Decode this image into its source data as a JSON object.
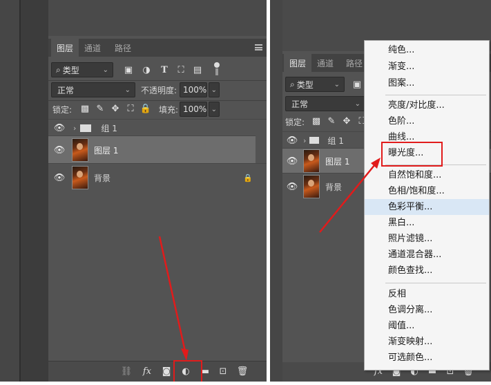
{
  "left": {
    "tabs": [
      "图层",
      "通道",
      "路径"
    ],
    "menu_icon": "menu-lines-icon",
    "filter_kind": "类型",
    "filter_icons": [
      "image-icon",
      "adjustment-icon",
      "text-icon",
      "transform-icon",
      "smart-object-icon",
      "toggle-icon"
    ],
    "blend_mode": "正常",
    "opacity_label": "不透明度:",
    "opacity_value": "100%",
    "lock_label": "锁定:",
    "fill_label": "填充:",
    "fill_value": "100%",
    "layers": [
      {
        "name": "组 1",
        "type": "group"
      },
      {
        "name": "图层 1",
        "type": "layer",
        "selected": true
      },
      {
        "name": "背景",
        "type": "background",
        "locked": true
      }
    ],
    "footer_icons": [
      "link-icon",
      "fx-icon",
      "mask-icon",
      "adjustment-layer-icon",
      "folder-icon",
      "new-layer-icon",
      "trash-icon"
    ]
  },
  "right": {
    "tabs": [
      "图层",
      "通道",
      "路径"
    ],
    "filter_kind": "类型",
    "blend_mode": "正常",
    "lock_label": "锁定:",
    "layers": [
      {
        "name": "组 1",
        "type": "group"
      },
      {
        "name": "图层 1",
        "type": "layer",
        "selected": true
      },
      {
        "name": "背景",
        "type": "background"
      }
    ],
    "menu": {
      "groups": [
        [
          "纯色...",
          "渐变...",
          "图案..."
        ],
        [
          "亮度/对比度...",
          "色阶...",
          "曲线...",
          "曝光度..."
        ],
        [
          "自然饱和度...",
          "色相/饱和度...",
          "色彩平衡...",
          "黑白...",
          "照片滤镜...",
          "通道混合器...",
          "颜色查找..."
        ],
        [
          "反相",
          "色调分离...",
          "阈值...",
          "渐变映射...",
          "可选颜色..."
        ]
      ],
      "highlighted": "曝光度...",
      "hovered": "色彩平衡..."
    }
  },
  "colors": {
    "panel": "#535353",
    "selected_row": "#6d6d6d",
    "annotation_red": "#e11b1b",
    "menu_bg": "#f5f5f5"
  }
}
